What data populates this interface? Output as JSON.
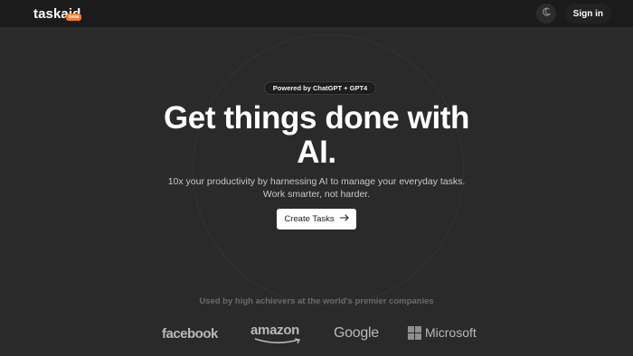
{
  "header": {
    "logo": "taskaid",
    "badge": "beta",
    "theme_icon": "moon-stars-icon",
    "signin_label": "Sign in"
  },
  "hero": {
    "pill_label": "Powered by ChatGPT + GPT4",
    "headline_line1": "Get things done with",
    "headline_line2": "AI.",
    "subtitle": "10x your productivity by harnessing AI to manage your everyday tasks. Work smarter, not harder.",
    "cta_label": "Create Tasks",
    "cta_icon": "arrow-right-icon"
  },
  "trusted": {
    "label": "Used by high achievers at the world's premier companies",
    "brands": [
      "facebook",
      "amazon",
      "Google",
      "Microsoft"
    ]
  },
  "colors": {
    "background": "#2a2a2b",
    "topbar": "#1b1b1c",
    "badge": "#f07d2e",
    "cta_bg": "#ffffff"
  }
}
